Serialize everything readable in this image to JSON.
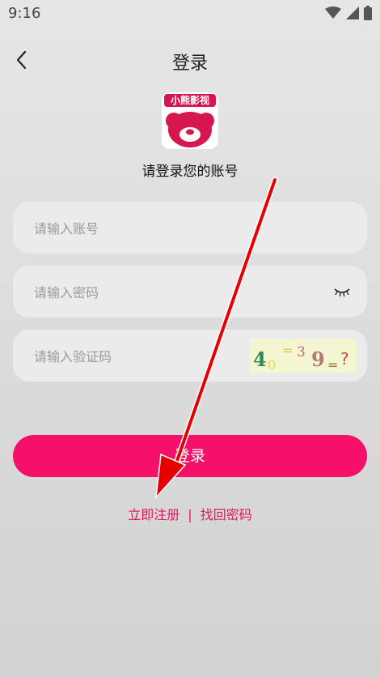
{
  "status": {
    "time": "9:16"
  },
  "nav": {
    "title": "登录"
  },
  "logo": {
    "text": "小熊影视"
  },
  "subtitle": "请登录您的账号",
  "fields": {
    "account_placeholder": "请输入账号",
    "password_placeholder": "请输入密码",
    "captcha_placeholder": "请输入验证码"
  },
  "captcha": {
    "text": "4 0 = 3 9 = ?"
  },
  "login_button": "登录",
  "links": {
    "register": "立即注册",
    "separator": "|",
    "forgot": "找回密码"
  },
  "colors": {
    "accent": "#f5106a",
    "link": "#e41462",
    "logo": "#d6174f"
  },
  "icons": [
    "back-arrow-icon",
    "wifi-icon",
    "signal-icon",
    "battery-icon",
    "eye-closed-icon"
  ]
}
